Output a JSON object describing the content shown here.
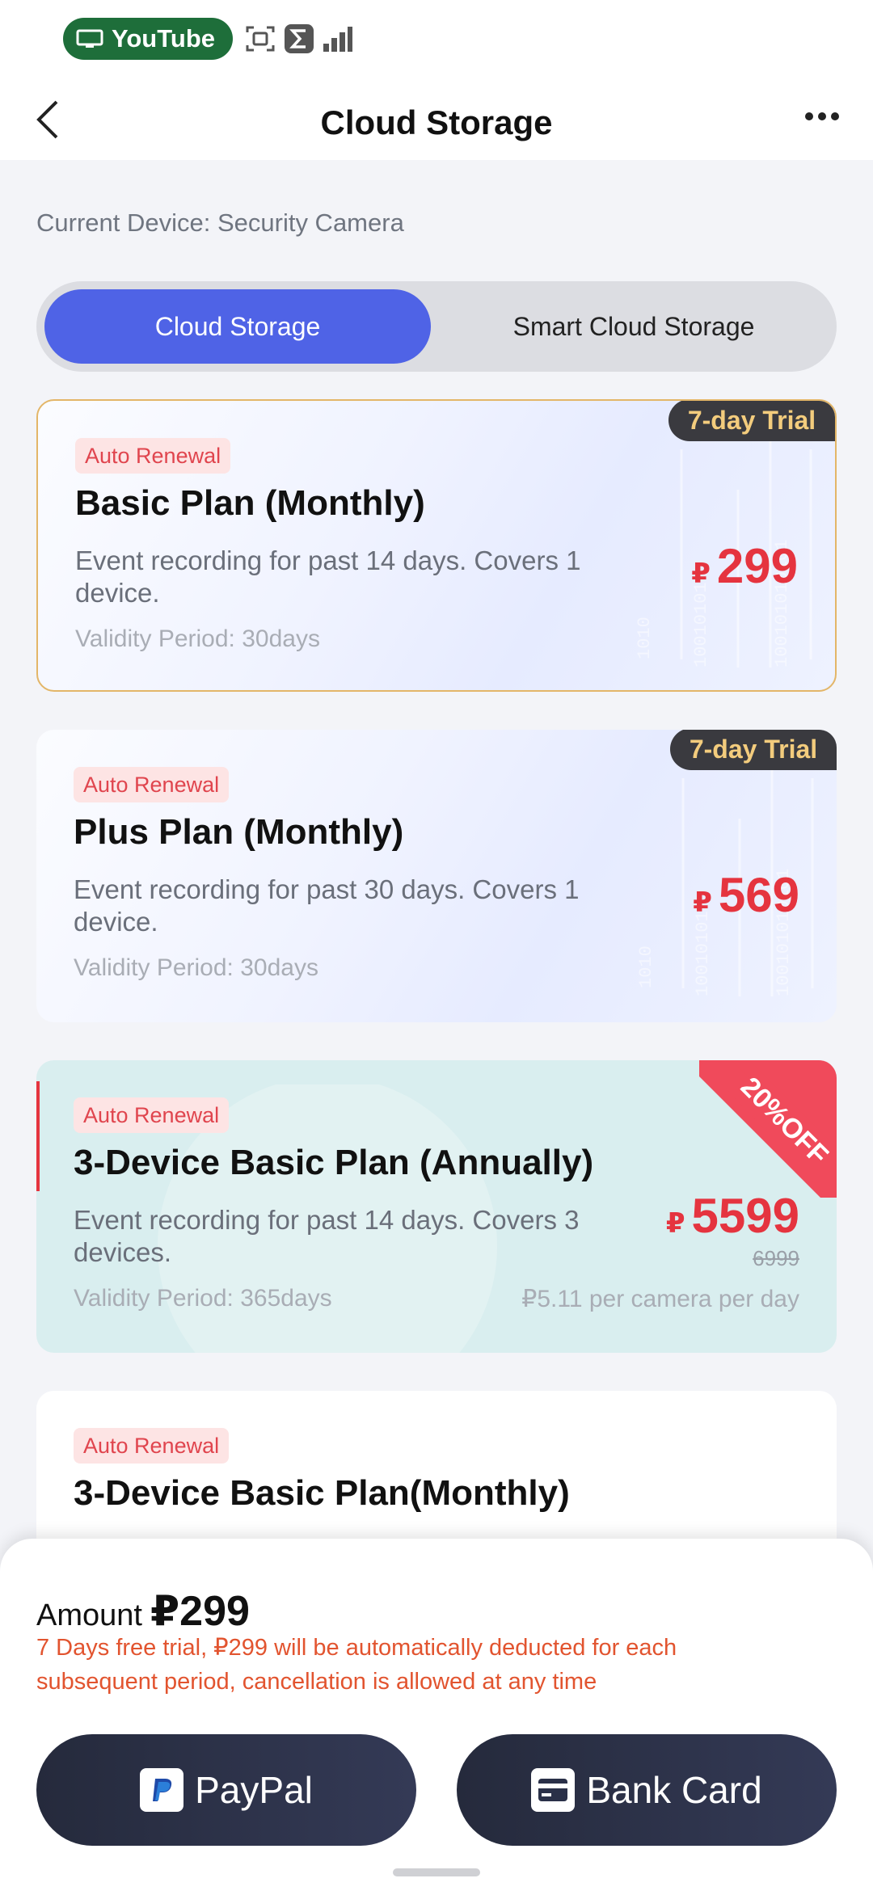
{
  "status_bar": {
    "app_pill": "YouTube"
  },
  "header": {
    "title": "Cloud Storage"
  },
  "device": {
    "label": "Current Device: Security Camera"
  },
  "tabs": [
    {
      "label": "Cloud Storage",
      "active": true
    },
    {
      "label": "Smart Cloud Storage",
      "active": false
    }
  ],
  "plans": [
    {
      "renewal_badge": "Auto Renewal",
      "name": "Basic Plan (Monthly)",
      "description": "Event recording for past 14 days. Covers 1 device.",
      "validity": "Validity Period: 30days",
      "currency": "₽",
      "price": "299",
      "trial_badge": "7-day Trial",
      "selected": true
    },
    {
      "renewal_badge": "Auto Renewal",
      "name": "Plus Plan (Monthly)",
      "description": "Event recording for past 30 days. Covers 1 device.",
      "validity": "Validity Period: 30days",
      "currency": "₽",
      "price": "569",
      "trial_badge": "7-day Trial"
    },
    {
      "renewal_badge": "Auto Renewal",
      "name": "3-Device Basic Plan (Annually)",
      "description": "Event recording for past 14 days. Covers 3 devices.",
      "validity": "Validity Period: 365days",
      "currency": "₽",
      "price": "5599",
      "old_price": "6999",
      "per_day": "₽5.11 per camera per day",
      "discount_badge": "20%OFF"
    },
    {
      "renewal_badge": "Auto Renewal",
      "name": "3-Device Basic Plan(Monthly)"
    }
  ],
  "payment": {
    "amount_label": "Amount",
    "amount_value": "₽299",
    "notice": "7 Days free trial, ₽299 will be automatically deducted for each subsequent period, cancellation is allowed at any time",
    "paypal_label": "PayPal",
    "bank_card_label": "Bank Card"
  },
  "colors": {
    "accent": "#4f63e6",
    "price_red": "#e5343f",
    "notice_orange": "#e2542f",
    "button_dark": "#252a3c",
    "trial_gold": "#f3cc7d"
  }
}
